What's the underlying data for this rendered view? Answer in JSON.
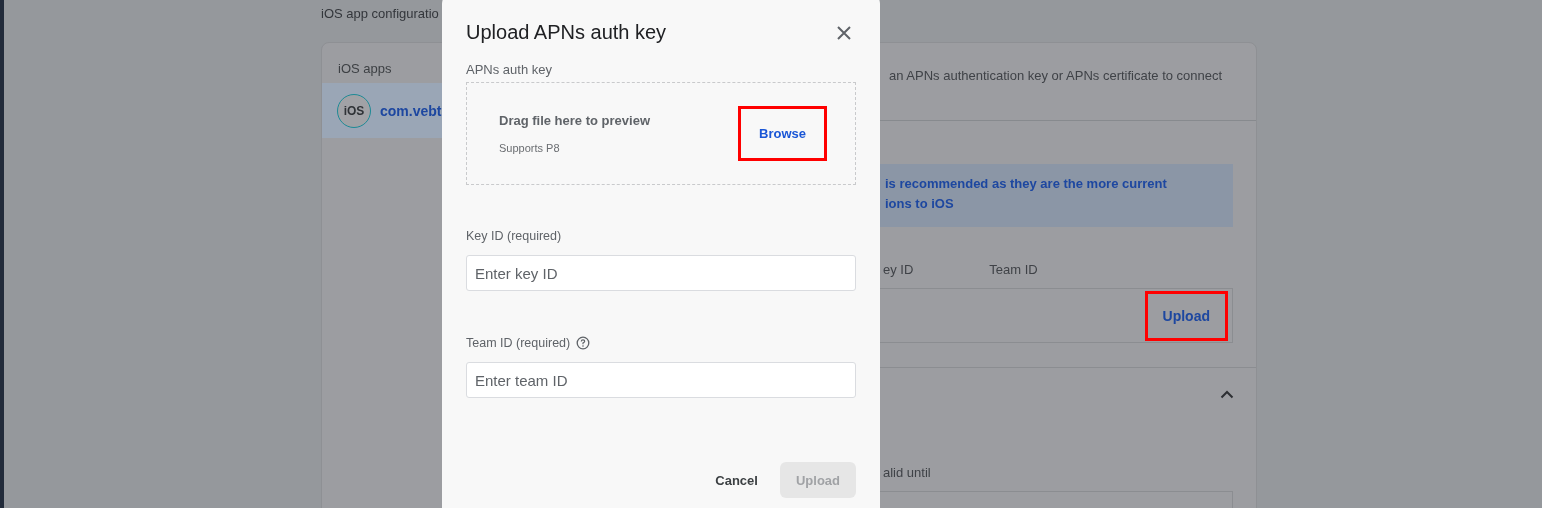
{
  "page": {
    "title": "iOS app configuratio"
  },
  "apps_panel": {
    "heading": "iOS apps",
    "items": [
      {
        "badge": "iOS",
        "name": "com.vebt",
        "selected": true
      }
    ]
  },
  "apns_panel": {
    "description": "an APNs authentication key or APNs certificate to connect",
    "notice_lines": [
      "is recommended as they are the more current",
      "ions to iOS"
    ],
    "columns": [
      "ey ID",
      "Team ID"
    ],
    "upload_button": {
      "label": "Upload",
      "highlighted": true
    }
  },
  "certificate_section": {
    "expanded": true,
    "columns": [
      "alid until"
    ]
  },
  "dialog": {
    "title": "Upload APNs auth key",
    "file_label": "APNs auth key",
    "dropzone": {
      "heading": "Drag file here to preview",
      "hint": "Supports P8",
      "browse_button": {
        "label": "Browse",
        "highlighted": true
      }
    },
    "fields": [
      {
        "label": "Key ID (required)",
        "placeholder": "Enter key ID",
        "help": false
      },
      {
        "label": "Team ID (required)",
        "placeholder": "Enter team ID",
        "help": true
      }
    ],
    "buttons": [
      {
        "label": "Cancel",
        "kind": "text",
        "disabled": false
      },
      {
        "label": "Upload",
        "kind": "filled",
        "disabled": true
      }
    ]
  }
}
